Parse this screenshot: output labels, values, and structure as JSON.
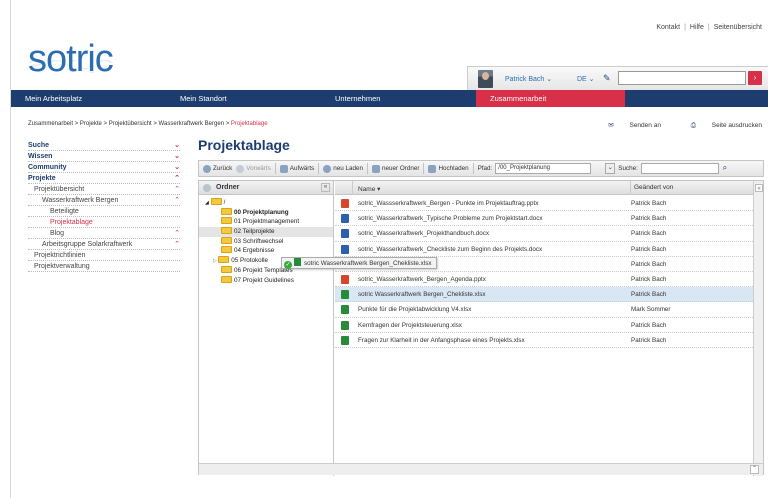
{
  "toplinks": {
    "kontakt": "Kontakt",
    "hilfe": "Hilfe",
    "sitemap": "Seitenübersicht"
  },
  "logo": "sotric",
  "user": {
    "name": "Patrick Bach ⌄",
    "lang": "DE ⌄"
  },
  "nav": [
    "Mein Arbeitsplatz",
    "Mein Standort",
    "Unternehmen",
    "Zusammenarbeit"
  ],
  "breadcrumb": {
    "path": "Zusammenarbeit > Projekte > Projektübersicht > Wasserkraftwerk Bergen > ",
    "current": "Projektablage"
  },
  "actions": {
    "send": "Senden an",
    "print": "Seite ausdrucken"
  },
  "sidenav": [
    {
      "label": "Suche",
      "level": "b",
      "chevron": "⌄"
    },
    {
      "label": "Wissen",
      "level": "b",
      "chevron": "⌄"
    },
    {
      "label": "Community",
      "level": "b",
      "chevron": "⌄"
    },
    {
      "label": "Projekte",
      "level": "b",
      "chevron": "⌃"
    },
    {
      "label": "Projektübersicht",
      "level": "l1",
      "chevron": "⌃"
    },
    {
      "label": "Wasserkraftwerk Bergen",
      "level": "l2",
      "chevron": "⌃"
    },
    {
      "label": "Beteiligte",
      "level": "l3",
      "chevron": ""
    },
    {
      "label": "Projektablage",
      "level": "l3 act",
      "chevron": ""
    },
    {
      "label": "Blog",
      "level": "l3",
      "chevron": "⌃"
    },
    {
      "label": "Arbeitsgruppe Solarkraftwerk",
      "level": "l2",
      "chevron": "⌃"
    },
    {
      "label": "Projektrichtlinien",
      "level": "l1",
      "chevron": ""
    },
    {
      "label": "Projektverwaltung",
      "level": "l1",
      "chevron": ""
    }
  ],
  "page_title": "Projektablage",
  "toolbar": {
    "back": "Zurück",
    "forward": "Vorwärts",
    "up": "Aufwärts",
    "reload": "neu Laden",
    "new_folder": "neuer Ordner",
    "upload": "Hochladen",
    "path_label": "Pfad:",
    "path_value": "/00_Projektplanung",
    "search_label": "Suche:"
  },
  "tree": {
    "header": "Ordner",
    "root": "/",
    "folders": [
      {
        "label": "00 Projektplanung",
        "cls": "bold"
      },
      {
        "label": "01 Projektmanagement",
        "cls": ""
      },
      {
        "label": "02 Teilprojekte",
        "cls": "sel"
      },
      {
        "label": "03 Schriftwechsel",
        "cls": ""
      },
      {
        "label": "04 Ergebnisse",
        "cls": ""
      },
      {
        "label": "05 Protokolle",
        "cls": ""
      },
      {
        "label": "06 Projekt Templates",
        "cls": ""
      },
      {
        "label": "07 Projekt Guidelines",
        "cls": ""
      }
    ]
  },
  "files": {
    "col_name": "Name ▾",
    "col_changed_by": "Geändert von",
    "rows": [
      {
        "name": "sotric_Wassserkraftwerk_Bergen - Punkte im Projektauftrag.pptx",
        "by": "Patrick Bach",
        "type": "pptx"
      },
      {
        "name": "sotric_Wasserkraftwerk_Typische Probleme zum Projektstart.docx",
        "by": "Patrick Bach",
        "type": "docx"
      },
      {
        "name": "sotric_Wasserkraftwerk_Projekthandbuch.docx",
        "by": "Patrick Bach",
        "type": "docx"
      },
      {
        "name": "sotric_Wasserkraftwerk_Checkliste zum Beginn des Projekts.docx",
        "by": "Patrick Bach",
        "type": "docx"
      },
      {
        "name": "Zeitplan.pptx",
        "by": "Patrick Bach",
        "type": "pptx"
      },
      {
        "name": "sotric_Wasserkraftwerk_Bergen_Agenda.pptx",
        "by": "Patrick Bach",
        "type": "pptx"
      },
      {
        "name": "sotric Wasserkraftwerk Bergen_Chekliste.xlsx",
        "by": "Patrick Bach",
        "type": "xlsx",
        "sel": true
      },
      {
        "name": "Punkte für die Projektabwicklung V4.xlsx",
        "by": "Mark Sommer",
        "type": "xlsx"
      },
      {
        "name": "Kernfragen der Projektsteuerung.xlsx",
        "by": "Patrick Bach",
        "type": "xlsx"
      },
      {
        "name": "Fragen zur Klarheit in der Anfangsphase eines Projekts.xlsx",
        "by": "Patrick Bach",
        "type": "xlsx"
      }
    ]
  },
  "drag_tooltip": "sotric Wasserkraftwerk Bergen_Chekliste.xlsx",
  "colors": {
    "brand_blue": "#1d3d6e",
    "accent_red": "#d9304a",
    "logo_blue": "#2a6db3"
  }
}
